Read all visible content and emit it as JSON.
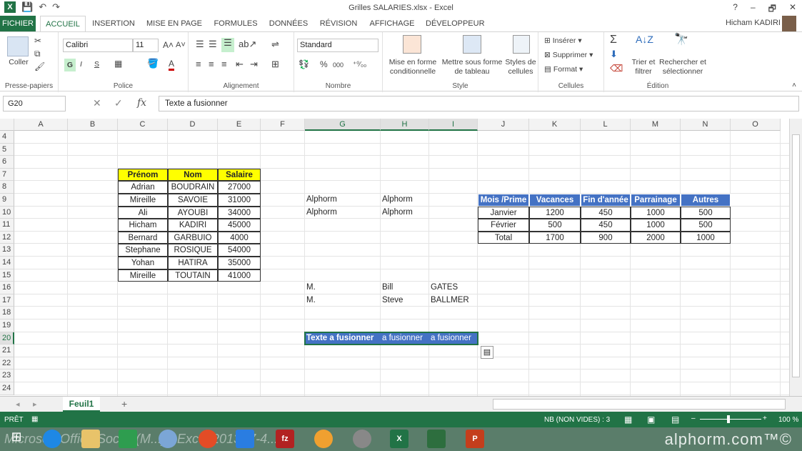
{
  "window": {
    "title": "Grilles SALARIES.xlsx - Excel",
    "help": "?",
    "minimize": "–",
    "restore": "🗗",
    "close": "✕"
  },
  "qat": {
    "save": "💾",
    "undo": "↶",
    "redo": "↷"
  },
  "tabs": [
    "FICHIER",
    "ACCUEIL",
    "INSERTION",
    "MISE EN PAGE",
    "FORMULES",
    "DONNÉES",
    "RÉVISION",
    "AFFICHAGE",
    "DÉVELOPPEUR"
  ],
  "user": "Hicham KADIRI",
  "ribbon": {
    "clipboard": {
      "paste": "Coller",
      "label": "Presse-papiers"
    },
    "font": {
      "name": "Calibri",
      "size": "11",
      "bold": "G",
      "italic": "I",
      "underline": "S",
      "label": "Police"
    },
    "alignment": {
      "label": "Alignement"
    },
    "number": {
      "format": "Standard",
      "percent": "%",
      "thousands": "000",
      "label": "Nombre"
    },
    "style": {
      "cond": "Mise en forme conditionnelle",
      "table": "Mettre sous forme de tableau",
      "cellstyles": "Styles de cellules",
      "label": "Style"
    },
    "cells": {
      "insert": "Insérer",
      "delete": "Supprimer",
      "format": "Format",
      "label": "Cellules"
    },
    "editing": {
      "sort": "Trier et filtrer",
      "find": "Rechercher et sélectionner",
      "label": "Édition"
    }
  },
  "formula": {
    "namebox": "G20",
    "fx": "fx",
    "content": "Texte a fusionner"
  },
  "columns": [
    "A",
    "B",
    "C",
    "D",
    "E",
    "F",
    "G",
    "H",
    "I",
    "J",
    "K",
    "L",
    "M",
    "N",
    "O"
  ],
  "rows": [
    "4",
    "5",
    "6",
    "7",
    "8",
    "9",
    "10",
    "11",
    "12",
    "13",
    "14",
    "15",
    "16",
    "17",
    "18",
    "19",
    "20",
    "21",
    "22",
    "23",
    "24"
  ],
  "table1": {
    "headers": [
      "Prénom",
      "Nom",
      "Salaire"
    ],
    "rows": [
      [
        "Adrian",
        "BOUDRAIN",
        "27000"
      ],
      [
        "Mireille",
        "SAVOIE",
        "31000"
      ],
      [
        "Ali",
        "AYOUBI",
        "34000"
      ],
      [
        "Hicham",
        "KADIRI",
        "45000"
      ],
      [
        "Bernard",
        "GARBUIO",
        "4000"
      ],
      [
        "Stephane",
        "ROSIQUE",
        "54000"
      ],
      [
        "Yohan",
        "HATIRA",
        "35000"
      ],
      [
        "Mireille",
        "TOUTAIN",
        "41000"
      ]
    ]
  },
  "misc": {
    "g9": "Alphorm",
    "h9": "Alphorm",
    "g10": "Alphorm",
    "h10": "Alphorm",
    "g16": "M.",
    "h16": "Bill",
    "i16": "GATES",
    "g17": "M.",
    "h17": "Steve",
    "i17": "BALLMER",
    "g20": "Texte a fusionner",
    "h20": "a fusionner",
    "i20": "a fusionner"
  },
  "table2": {
    "headers": [
      "Mois /Prime",
      "Vacances",
      "Fin d'année",
      "Parrainage",
      "Autres"
    ],
    "rows": [
      [
        "Janvier",
        "1200",
        "450",
        "1000",
        "500"
      ],
      [
        "Février",
        "500",
        "450",
        "1000",
        "500"
      ],
      [
        "Total",
        "1700",
        "900",
        "2000",
        "1000"
      ]
    ]
  },
  "sheet": {
    "name": "Feuil1",
    "add": "+"
  },
  "status": {
    "ready": "PRÊT",
    "count": "NB (NON VIDES) : 3",
    "zoom": "100 %"
  },
  "taskbar": {
    "watermark": "alphorm.com™©",
    "ghost": "Microsoft Office Social (M...) - Excel 2013 (7-4...)"
  },
  "colors": {
    "excel_green": "#217346",
    "yellow": "#ffff00",
    "blue": "#4472c4"
  }
}
